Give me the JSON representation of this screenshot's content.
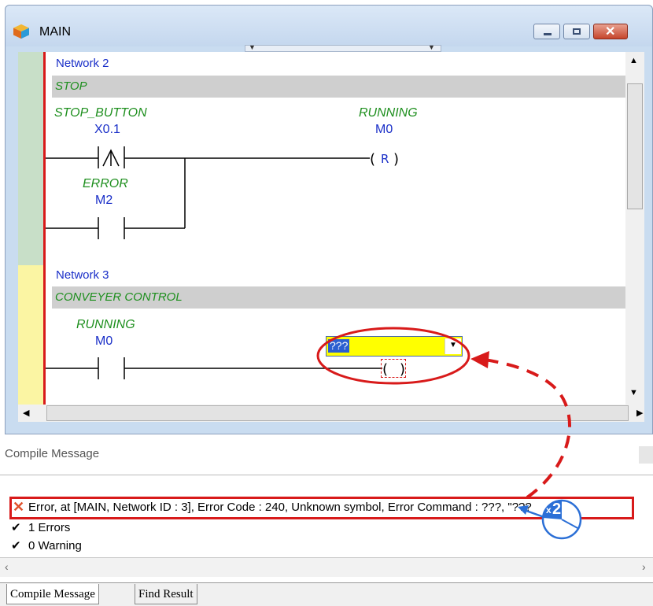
{
  "window": {
    "title": "MAIN",
    "controls": {
      "minimize": "minimize",
      "maximize": "maximize",
      "close": "close"
    }
  },
  "networks": [
    {
      "label": "Network 2",
      "comment": "STOP",
      "contacts": [
        {
          "symbol": "STOP_BUTTON",
          "address": "X0.1"
        },
        {
          "symbol": "ERROR",
          "address": "M2"
        }
      ],
      "coil": {
        "symbol": "RUNNING",
        "address": "M0",
        "type": "R"
      }
    },
    {
      "label": "Network 3",
      "comment": "CONVEYER CONTROL",
      "contacts": [
        {
          "symbol": "RUNNING",
          "address": "M0"
        }
      ],
      "coil_dropdown": {
        "value": "???"
      }
    }
  ],
  "compile": {
    "title": "Compile Message",
    "error": "Error, at [MAIN, Network ID : 3], Error Code : 240, Unknown symbol, Error Command : ???, \"???",
    "errors_line": "1 Errors",
    "warnings_line": "0 Warning"
  },
  "annotation": {
    "badge": "2",
    "badge_prefix": "x"
  },
  "tabs": [
    "Compile Message",
    "Find Result"
  ],
  "colors": {
    "error_red": "#d81a1a",
    "symbol_green": "#1e8f1e",
    "address_blue": "#1a2fc8",
    "highlight_yellow": "#ffff00"
  }
}
